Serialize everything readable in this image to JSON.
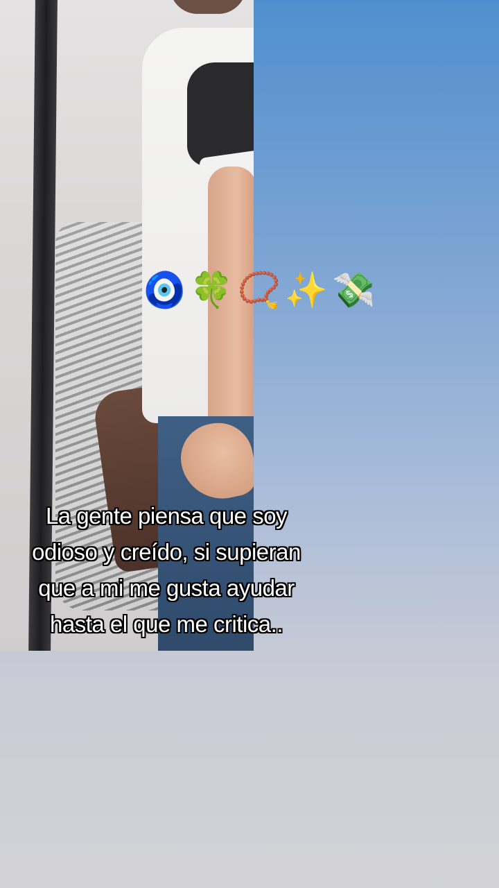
{
  "background": {
    "top_color": "#4f8fcf",
    "bottom_color": "#d3d3d7"
  },
  "emojis": [
    {
      "name": "nazar-amulet-icon",
      "glyph": "🧿"
    },
    {
      "name": "four-leaf-clover-icon",
      "glyph": "🍀"
    },
    {
      "name": "prayer-beads-icon",
      "glyph": "📿"
    },
    {
      "name": "sparkles-icon",
      "glyph": "✨"
    },
    {
      "name": "money-with-wings-icon",
      "glyph": "💸"
    }
  ],
  "caption": {
    "lines": [
      "La gente piensa que soy",
      "odioso y creído, si supieran",
      "que a mi me gusta ayudar",
      "hasta el que me critica.."
    ]
  }
}
